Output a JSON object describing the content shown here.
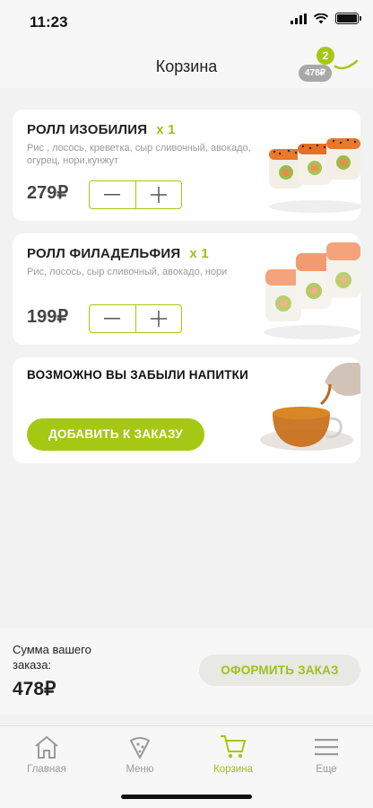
{
  "status": {
    "time": "11:23"
  },
  "header": {
    "title": "Корзина",
    "cart_count": "2",
    "cart_total": "478₽"
  },
  "cart": {
    "items": [
      {
        "name": "РОЛЛ ИЗОБИЛИЯ",
        "qty": "x 1",
        "description": "Рис , лосось, креветка, сыр сливочный, авокадо, огурец, нори,кунжут",
        "price": "279₽"
      },
      {
        "name": "РОЛЛ ФИЛАДЕЛЬФИЯ",
        "qty": "x 1",
        "description": "Рис, лосось, сыр сливочный, авокадо, нори",
        "price": "199₽"
      }
    ],
    "promo": {
      "title": "ВОЗМОЖНО ВЫ ЗАБЫЛИ НАПИТКИ",
      "button": "ДОБАВИТЬ К ЗАКАЗУ"
    }
  },
  "summary": {
    "label": "Сумма вашего заказа:",
    "total": "478₽",
    "checkout": "ОФОРМИТЬ ЗАКАЗ"
  },
  "tabbar": [
    {
      "label": "Главная",
      "icon": "home-icon"
    },
    {
      "label": "Меню",
      "icon": "pizza-icon"
    },
    {
      "label": "Корзина",
      "icon": "cart-icon",
      "active": true
    },
    {
      "label": "Еще",
      "icon": "menu-icon"
    }
  ],
  "colors": {
    "accent": "#a5c815",
    "background": "#f2f2f2",
    "inactive": "#9a9a9a"
  }
}
